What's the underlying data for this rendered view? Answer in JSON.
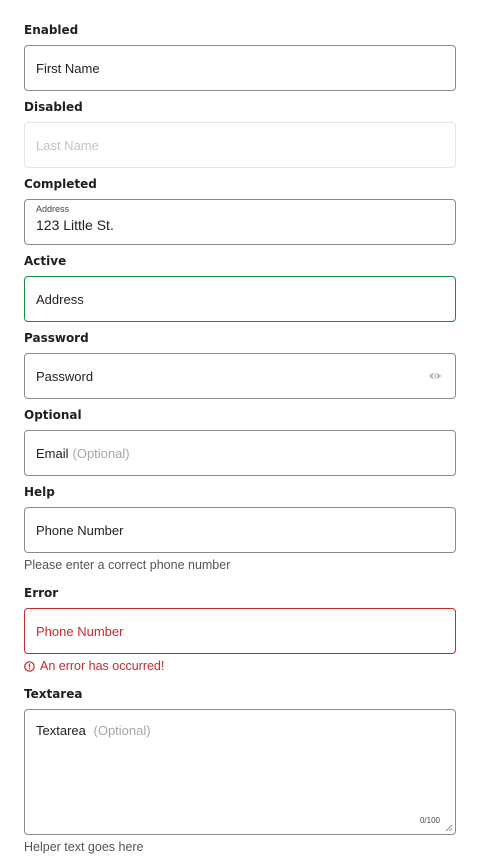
{
  "fields": {
    "enabled": {
      "label": "Enabled",
      "placeholder": "First Name"
    },
    "disabled": {
      "label": "Disabled",
      "placeholder": "Last Name"
    },
    "completed": {
      "label": "Completed",
      "inner_label": "Address",
      "value": "123 Little St."
    },
    "active": {
      "label": "Active",
      "placeholder": "Address"
    },
    "password": {
      "label": "Password",
      "placeholder": "Password",
      "icon": "eye-icon"
    },
    "optional": {
      "label": "Optional",
      "placeholder": "Email",
      "optional_text": "(Optional)"
    },
    "help": {
      "label": "Help",
      "placeholder": "Phone Number",
      "helper_text": "Please enter a correct phone number"
    },
    "error": {
      "label": "Error",
      "placeholder": "Phone Number",
      "error_text": "An error has occurred!",
      "icon": "alert-circle-icon"
    },
    "textarea": {
      "label": "Textarea",
      "placeholder": "Textarea",
      "optional_text": "(Optional)",
      "counter": "0/100",
      "helper_text": "Helper text goes here"
    }
  },
  "colors": {
    "border": "#8a8a8a",
    "active_border": "#1a8a4a",
    "error": "#c3292d",
    "disabled_border": "#e4e4e4",
    "muted_text": "#a6a6a6"
  }
}
